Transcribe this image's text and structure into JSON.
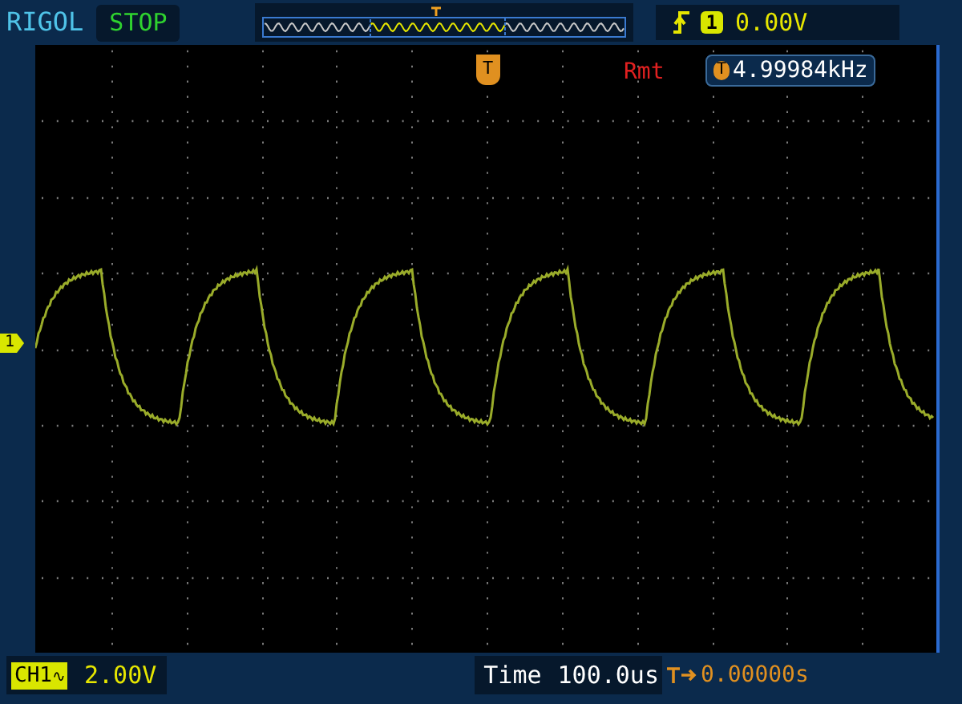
{
  "brand": "RIGOL",
  "run_state": "STOP",
  "trigger": {
    "channel": "1",
    "level": "0.00V"
  },
  "screen": {
    "trigger_position_label": "T",
    "mode": "Rmt",
    "frequency": {
      "badge": "T",
      "value": "4.99984kHz"
    },
    "channel_marker": "1"
  },
  "channel": {
    "label": "CH1",
    "coupling": "∿",
    "scale": "2.00V"
  },
  "timebase": {
    "label": "Time",
    "scale": "100.0us",
    "offset": "0.00000s"
  }
}
